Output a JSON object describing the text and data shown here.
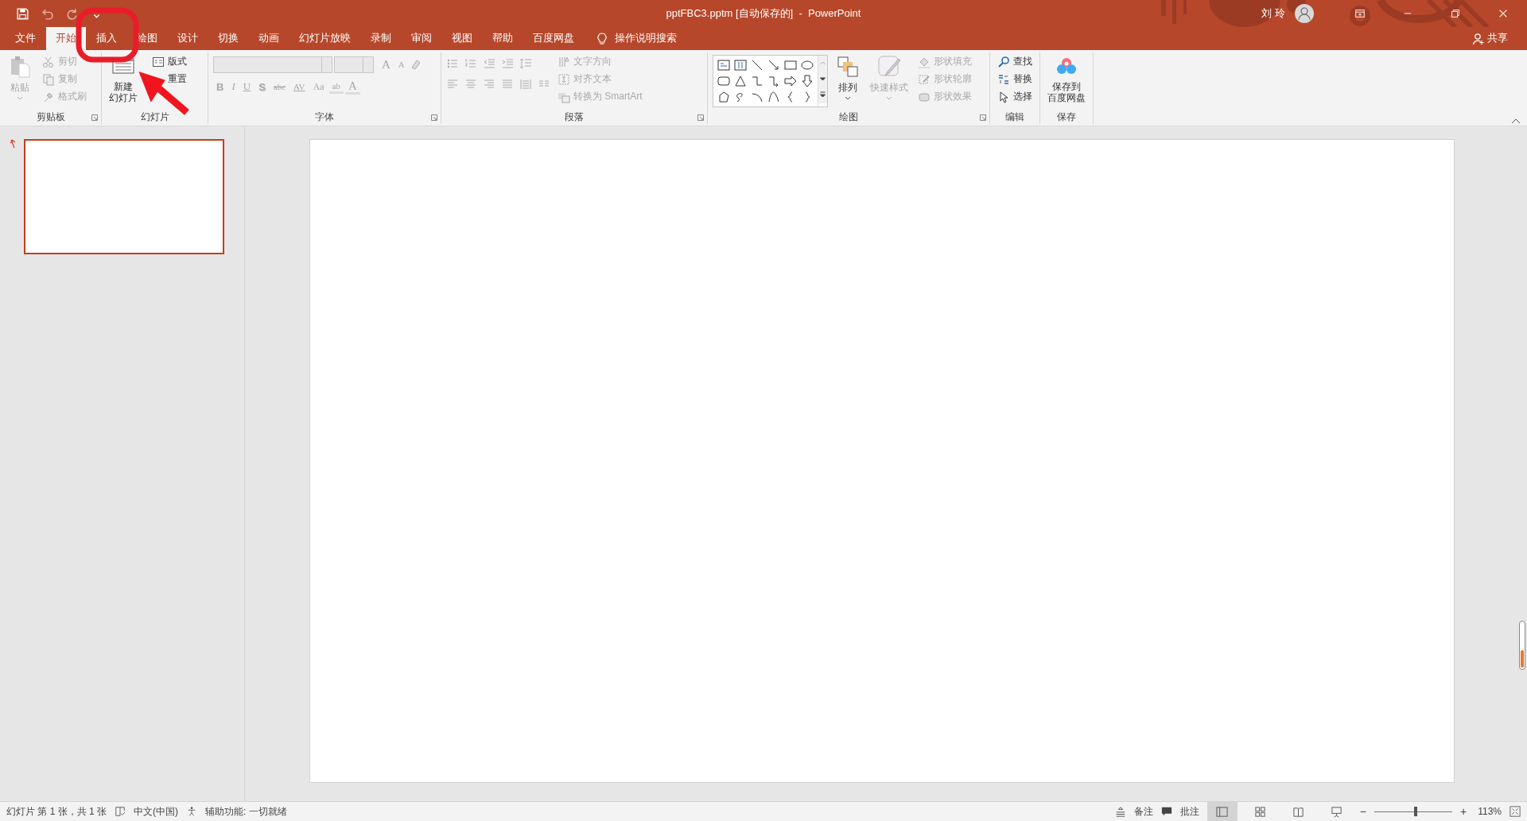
{
  "window": {
    "title": "pptFBC3.pptm [自动保存的]  -  PowerPoint",
    "user": "刘 玲",
    "share": "共享"
  },
  "tabs": [
    {
      "label": "文件",
      "selected": false
    },
    {
      "label": "开始",
      "selected": true
    },
    {
      "label": "插入",
      "selected": false
    },
    {
      "label": "绘图",
      "selected": false
    },
    {
      "label": "设计",
      "selected": false
    },
    {
      "label": "切换",
      "selected": false
    },
    {
      "label": "动画",
      "selected": false
    },
    {
      "label": "幻灯片放映",
      "selected": false
    },
    {
      "label": "录制",
      "selected": false
    },
    {
      "label": "审阅",
      "selected": false
    },
    {
      "label": "视图",
      "selected": false
    },
    {
      "label": "帮助",
      "selected": false
    },
    {
      "label": "百度网盘",
      "selected": false
    }
  ],
  "tell_me": "操作说明搜索",
  "clipboard": {
    "title": "剪贴板",
    "paste": {
      "label": "粘贴",
      "disabled": true
    },
    "items": [
      {
        "label": "剪切",
        "disabled": true
      },
      {
        "label": "复制",
        "disabled": true
      },
      {
        "label": "格式刷",
        "disabled": true
      }
    ]
  },
  "slides_group": {
    "title": "幻灯片",
    "new_slide": {
      "lines": [
        "新建",
        "幻灯片"
      ],
      "disabled": false
    },
    "items": [
      {
        "label": "版式",
        "disabled": false
      },
      {
        "label": "重置",
        "disabled": false
      }
    ]
  },
  "font": {
    "title": "字体",
    "disabled": true,
    "row1": [
      {
        "kind": "grow",
        "label": "A"
      },
      {
        "kind": "shrink",
        "label": "A"
      }
    ],
    "row2": [
      {
        "kind": "bold",
        "label": "B"
      },
      {
        "kind": "italic",
        "label": "I"
      },
      {
        "kind": "underline",
        "label": "U"
      },
      {
        "kind": "shadow",
        "label": "S"
      },
      {
        "kind": "strike",
        "label": "abc"
      },
      {
        "kind": "spacing",
        "label": "AV"
      },
      {
        "kind": "case",
        "label": "Aa"
      },
      {
        "kind": "highlight",
        "label": "ab"
      },
      {
        "kind": "color",
        "label": "A"
      }
    ]
  },
  "paragraph": {
    "title": "段落",
    "items": [
      {
        "label": "文字方向",
        "disabled": true
      },
      {
        "label": "对齐文本",
        "disabled": true
      },
      {
        "label": "转换为 SmartArt",
        "disabled": true
      }
    ]
  },
  "drawing": {
    "title": "绘图",
    "arrange": {
      "label": "排列",
      "disabled": false
    },
    "quick_styles": {
      "label": "快速样式",
      "disabled": true
    },
    "items": [
      {
        "label": "形状填充",
        "disabled": true
      },
      {
        "label": "形状轮廓",
        "disabled": true
      },
      {
        "label": "形状效果",
        "disabled": true
      }
    ]
  },
  "editing": {
    "title": "编辑",
    "items": [
      {
        "label": "查找",
        "disabled": false
      },
      {
        "label": "替换",
        "disabled": false
      },
      {
        "label": "选择",
        "disabled": false
      }
    ]
  },
  "save": {
    "title": "保存",
    "lines": [
      "保存到",
      "百度网盘"
    ]
  },
  "slides": [
    {
      "selected": true
    }
  ],
  "status_bar": {
    "slide_info": "幻灯片 第 1 张，共 1 张",
    "language": "中文(中国)",
    "accessibility": "辅助功能: 一切就绪",
    "notes": "备注",
    "comments": "批注",
    "views": [
      {
        "selected": true
      },
      {
        "selected": false
      },
      {
        "selected": false
      },
      {
        "selected": false
      }
    ],
    "zoom": {
      "zoom_out": "−",
      "level": 0.53,
      "zoom_in": "+",
      "reading": "113%"
    }
  }
}
